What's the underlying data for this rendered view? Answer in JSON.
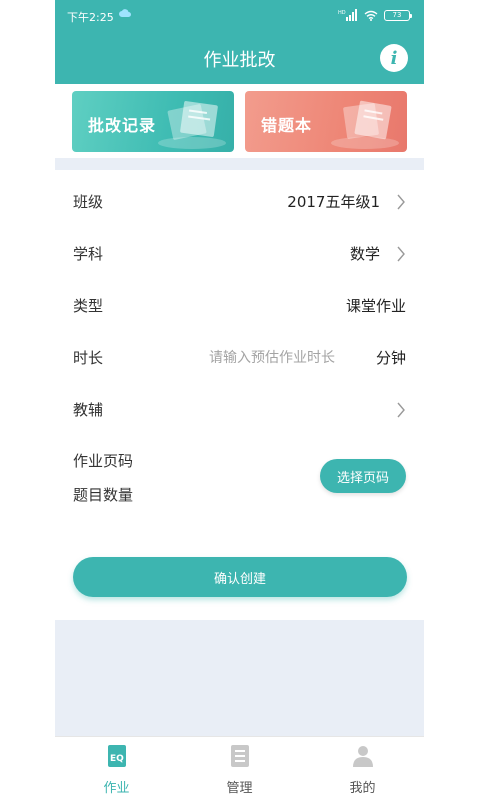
{
  "status_bar": {
    "time": "下午2:25",
    "network": "HD",
    "battery": "73"
  },
  "header": {
    "title": "作业批改",
    "info_icon": "info-icon"
  },
  "cards": {
    "review_label": "批改记录",
    "wrong_label": "错题本",
    "review_color": "#3fbcb3",
    "wrong_color": "#ee8676"
  },
  "form": {
    "class": {
      "label": "班级",
      "value": "2017五年级1"
    },
    "subject": {
      "label": "学科",
      "value": "数学"
    },
    "type": {
      "label": "类型",
      "value": "课堂作业"
    },
    "duration": {
      "label": "时长",
      "placeholder": "请输入预估作业时长",
      "unit": "分钟"
    },
    "tutor": {
      "label": "教辅",
      "value": ""
    },
    "page_code_label": "作业页码",
    "question_count_label": "题目数量",
    "select_page_button": "选择页码"
  },
  "confirm_button": "确认创建",
  "tabs": [
    {
      "label": "作业",
      "icon": "homework-icon",
      "active": true
    },
    {
      "label": "管理",
      "icon": "manage-icon",
      "active": false
    },
    {
      "label": "我的",
      "icon": "profile-icon",
      "active": false
    }
  ],
  "colors": {
    "accent": "#3db5b0",
    "page_bg": "#e9eef6"
  }
}
